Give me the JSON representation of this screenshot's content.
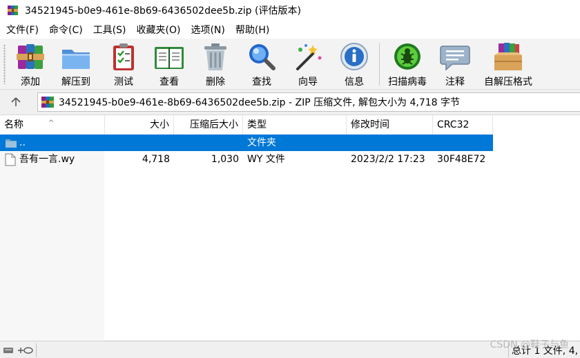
{
  "window": {
    "title": "34521945-b0e9-461e-8b69-6436502dee5b.zip (评估版本)"
  },
  "menu": [
    {
      "label": "文件(F)"
    },
    {
      "label": "命令(C)"
    },
    {
      "label": "工具(S)"
    },
    {
      "label": "收藏夹(O)"
    },
    {
      "label": "选项(N)"
    },
    {
      "label": "帮助(H)"
    }
  ],
  "toolbar": [
    {
      "label": "添加",
      "icon": "add-books-icon"
    },
    {
      "label": "解压到",
      "icon": "extract-folder-icon"
    },
    {
      "label": "测试",
      "icon": "test-clipboard-icon"
    },
    {
      "label": "查看",
      "icon": "view-book-icon"
    },
    {
      "label": "删除",
      "icon": "trash-icon"
    },
    {
      "label": "查找",
      "icon": "magnifier-icon"
    },
    {
      "label": "向导",
      "icon": "wizard-wand-icon"
    },
    {
      "label": "信息",
      "icon": "info-icon"
    },
    {
      "label": "扫描病毒",
      "icon": "virus-scan-icon"
    },
    {
      "label": "注释",
      "icon": "comment-icon"
    },
    {
      "label": "自解压格式",
      "icon": "sfx-box-icon"
    }
  ],
  "address": {
    "up_icon": "up-arrow-icon",
    "path": "34521945-b0e9-461e-8b69-6436502dee5b.zip - ZIP 压缩文件, 解包大小为 4,718 字节"
  },
  "columns": {
    "name": "名称",
    "size": "大小",
    "packed": "压缩后大小",
    "type": "类型",
    "modified": "修改时间",
    "crc": "CRC32"
  },
  "rows": [
    {
      "name": "..",
      "size": "",
      "packed": "",
      "type": "文件夹",
      "modified": "",
      "crc": "",
      "selected": true,
      "icon": "folder-icon"
    },
    {
      "name": "吾有一言.wy",
      "size": "4,718",
      "packed": "1,030",
      "type": "WY 文件",
      "modified": "2023/2/2 17:23",
      "crc": "30F48E72",
      "selected": false,
      "icon": "file-icon"
    }
  ],
  "status": {
    "text": "总计 1 文件, 4,",
    "watermark": "CSDN @鞋子与鱼"
  },
  "colors": {
    "selection": "#0078d7",
    "toolbar_bg": "#f3f3f3"
  }
}
